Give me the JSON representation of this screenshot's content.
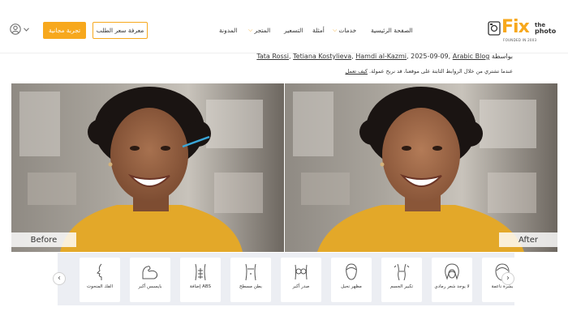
{
  "header": {
    "trial_button": "تجربة مجانية",
    "price_button": "معرفة سعر الطلب",
    "nav": {
      "home": "الصفحة الرئيسية",
      "services": "خدمات",
      "examples": "أمثلة",
      "pricing": "التسعير",
      "store": "المتجر",
      "blog": "المدونة"
    },
    "logo": {
      "brand": "Fix",
      "tagline_1": "the",
      "tagline_2": "photo",
      "founded": "FOUNDED IN 2003"
    },
    "accent_color": "#f7a81d"
  },
  "article": {
    "by": "بواسطة",
    "authors": [
      "Tata Rossi",
      "Tetiana Kostylieva",
      "Hamdi al-Kazmi"
    ],
    "date": "2025-09-09",
    "category": "Arabic Blog",
    "disclaimer_text": "عندما تشتري من خلال الروابط الثابتة على موقعنا، قد نربح عمولة.",
    "disclaimer_link": "كيف تعمل"
  },
  "comparison": {
    "before_label": "Before",
    "after_label": "After"
  },
  "carousel": {
    "items": [
      {
        "label": "بشرة ناعمة",
        "icon": "face-icon"
      },
      {
        "label": "لا يوجد شعر رمادي",
        "icon": "hair-icon"
      },
      {
        "label": "تكبير الجسم",
        "icon": "body-enlarge-icon"
      },
      {
        "label": "مظهر نحيل",
        "icon": "slim-face-icon"
      },
      {
        "label": "صدر أكبر",
        "icon": "chest-icon"
      },
      {
        "label": "بطن مسطح",
        "icon": "flat-belly-icon"
      },
      {
        "label": "إضافة ABS",
        "icon": "abs-icon"
      },
      {
        "label": "بايسبس أكبر",
        "icon": "biceps-icon"
      },
      {
        "label": "الفك المنحوت",
        "icon": "jawline-icon"
      }
    ]
  }
}
